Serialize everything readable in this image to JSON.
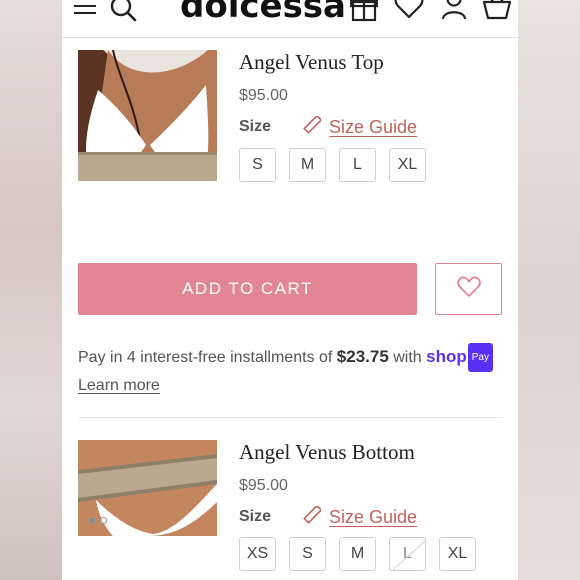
{
  "header": {
    "logo": "dolcessa",
    "menu_icon": "menu-icon",
    "search_icon": "search-icon",
    "gift_icon": "gift-icon",
    "wishlist_icon": "heart-icon",
    "account_icon": "account-icon",
    "cart_icon": "basket-icon"
  },
  "products": [
    {
      "title": "Angel Venus Top",
      "price": "$95.00",
      "size_label": "Size",
      "size_guide": "Size Guide",
      "sizes": [
        "S",
        "M",
        "L",
        "XL"
      ]
    },
    {
      "title": "Angel Venus Bottom",
      "price": "$95.00",
      "size_label": "Size",
      "size_guide": "Size Guide",
      "sizes": [
        "XS",
        "S",
        "M",
        "L",
        "XL"
      ],
      "unavailable_sizes": [
        "L"
      ]
    }
  ],
  "cart": {
    "add_to_cart": "ADD TO CART"
  },
  "shop_pay": {
    "prefix": "Pay in 4 interest-free installments of",
    "amount": "$23.75",
    "with": "with",
    "brand": "shop",
    "badge": "Pay",
    "learn_more": "Learn more"
  },
  "colors": {
    "accent": "#e28696",
    "link": "#c0645d",
    "shop_pay": "#5a31f4"
  }
}
